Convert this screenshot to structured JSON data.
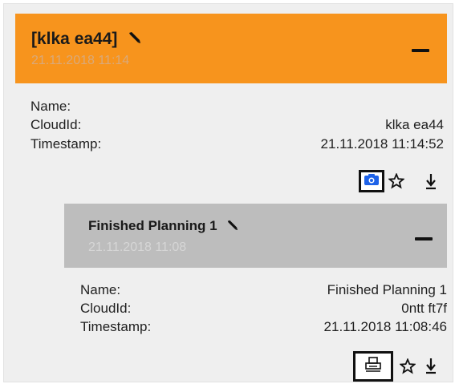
{
  "colors": {
    "accent": "#f7941d",
    "camera": "#1e62e8"
  },
  "main_item": {
    "title": "[klka ea44]",
    "subtitle": "21.11.2018 11:14",
    "fields": {
      "name_label": "Name:",
      "name_value": "",
      "cloudid_label": "CloudId:",
      "cloudid_value": "klka ea44",
      "timestamp_label": "Timestamp:",
      "timestamp_value": "21.11.2018 11:14:52"
    },
    "actions": [
      "camera-icon",
      "star-icon",
      "download-icon"
    ]
  },
  "child_item": {
    "title": "Finished Planning 1",
    "subtitle": "21.11.2018 11:08",
    "fields": {
      "name_label": "Name:",
      "name_value": "Finished Planning 1",
      "cloudid_label": "CloudId:",
      "cloudid_value": "0ntt ft7f",
      "timestamp_label": "Timestamp:",
      "timestamp_value": "21.11.2018 11:08:46"
    },
    "actions": [
      "printer-icon",
      "star-icon",
      "download-icon"
    ]
  }
}
